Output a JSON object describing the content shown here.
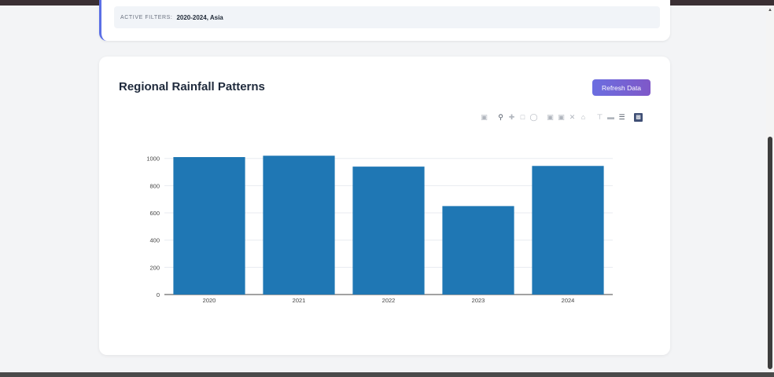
{
  "filters": {
    "label": "ACTIVE FILTERS:",
    "value": "2020-2024, Asia"
  },
  "card": {
    "title": "Regional Rainfall Patterns",
    "refresh_label": "Refresh Data"
  },
  "modebar": {
    "icons": [
      "camera-icon",
      "zoom-icon",
      "pan-icon",
      "box-select-icon",
      "lasso-icon",
      "zoom-in-icon",
      "zoom-out-icon",
      "autoscale-icon",
      "reset-axes-icon",
      "spike-lines-icon",
      "hover-closest-icon",
      "hover-compare-icon",
      "plotly-logo-icon"
    ]
  },
  "chart_data": {
    "type": "bar",
    "categories": [
      "2020",
      "2021",
      "2022",
      "2023",
      "2024"
    ],
    "values": [
      1010,
      1020,
      940,
      650,
      945
    ],
    "ylim": [
      0,
      1000
    ],
    "yticks": [
      0,
      200,
      400,
      600,
      800,
      1000
    ],
    "color": "#1f77b4",
    "grid": true
  }
}
